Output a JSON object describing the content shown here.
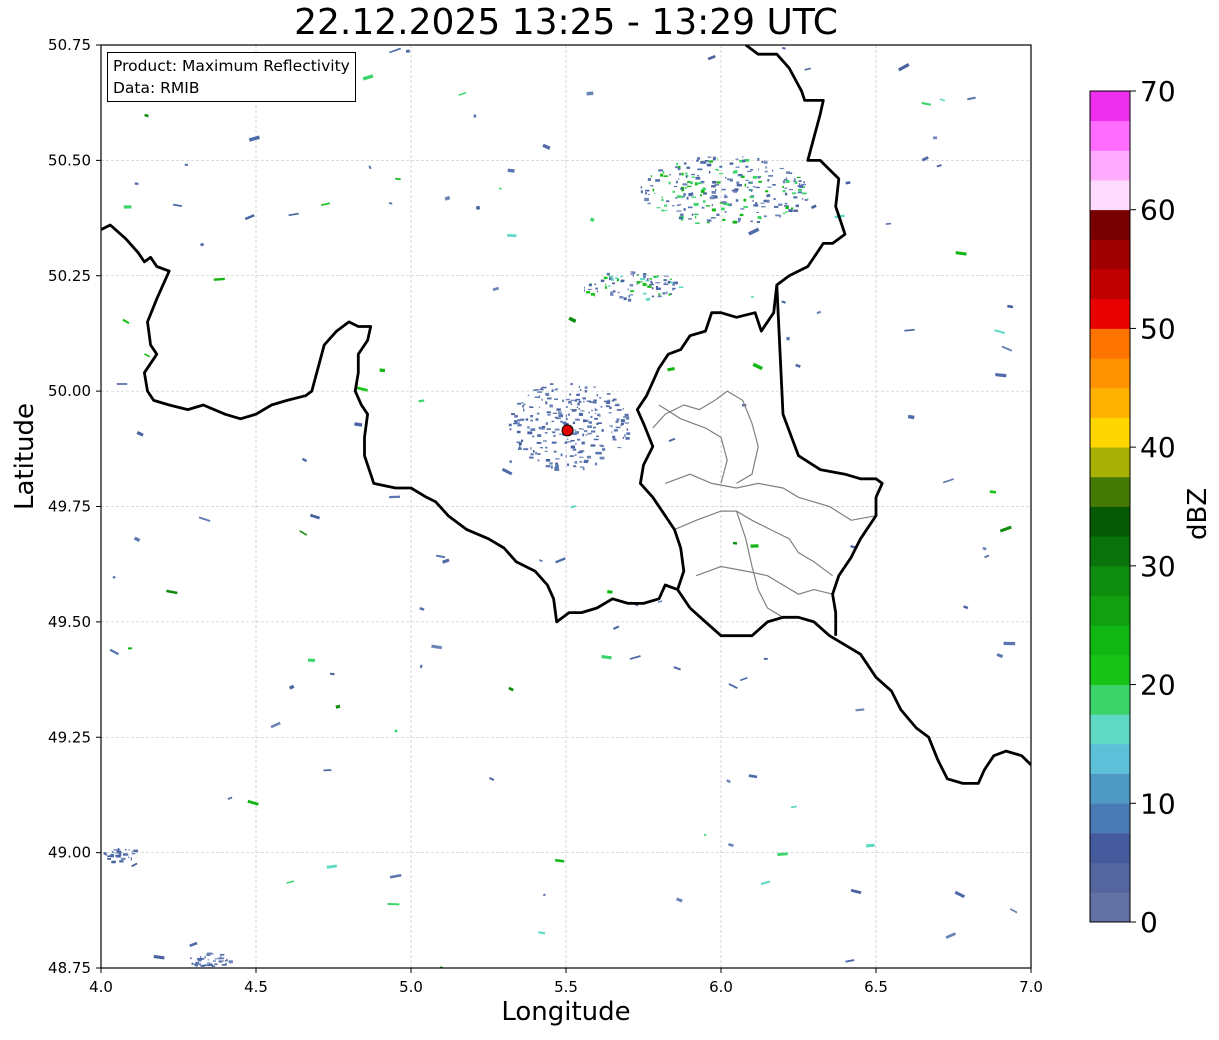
{
  "header": {
    "title": "22.12.2025 13:25 - 13:29 UTC"
  },
  "info": {
    "product": "Product: Maximum Reflectivity",
    "source": "Data: RMIB"
  },
  "axes": {
    "xlabel": "Longitude",
    "ylabel": "Latitude",
    "xlim": [
      4.0,
      7.0
    ],
    "ylim": [
      48.75,
      50.75
    ],
    "xticks": [
      "4.0",
      "4.5",
      "5.0",
      "5.5",
      "6.0",
      "6.5",
      "7.0"
    ],
    "xtick_values": [
      4.0,
      4.5,
      5.0,
      5.5,
      6.0,
      6.5,
      7.0
    ],
    "yticks": [
      "48.75",
      "49.00",
      "49.25",
      "49.50",
      "49.75",
      "50.00",
      "50.25",
      "50.50",
      "50.75"
    ],
    "ytick_values": [
      48.75,
      49.0,
      49.25,
      49.5,
      49.75,
      50.0,
      50.25,
      50.5,
      50.75
    ],
    "grid": true
  },
  "colorbar": {
    "label": "dBZ",
    "range": [
      0,
      70
    ],
    "ticks": [
      "0",
      "10",
      "20",
      "30",
      "40",
      "50",
      "60",
      "70"
    ],
    "tick_values": [
      0,
      10,
      20,
      30,
      40,
      50,
      60,
      70
    ],
    "colors": [
      "#6272a4",
      "#55669e",
      "#465b9d",
      "#4a7bb4",
      "#4f9ac4",
      "#5dbfd8",
      "#5fd8c4",
      "#3cd46a",
      "#18c418",
      "#12b612",
      "#10a010",
      "#0e8c0e",
      "#0a720a",
      "#065a06",
      "#467a06",
      "#a8b006",
      "#ffd600",
      "#ffb000",
      "#ff9200",
      "#ff7400",
      "#e80000",
      "#c00000",
      "#a00000",
      "#780000",
      "#ffdcff",
      "#ffaaff",
      "#ff6cff",
      "#ee30ee"
    ]
  },
  "radar_site": {
    "lon": 5.505,
    "lat": 49.915,
    "color": "#e00000"
  },
  "borders": {
    "country": [
      [
        [
          4.0,
          50.35
        ],
        [
          4.03,
          50.36
        ],
        [
          4.08,
          50.33
        ],
        [
          4.12,
          50.3
        ],
        [
          4.14,
          50.28
        ],
        [
          4.16,
          50.29
        ],
        [
          4.18,
          50.27
        ],
        [
          4.22,
          50.26
        ],
        [
          4.18,
          50.2
        ],
        [
          4.15,
          50.15
        ],
        [
          4.16,
          50.1
        ],
        [
          4.18,
          50.08
        ],
        [
          4.14,
          50.04
        ],
        [
          4.15,
          50.0
        ],
        [
          4.17,
          49.98
        ],
        [
          4.22,
          49.97
        ],
        [
          4.28,
          49.96
        ],
        [
          4.33,
          49.97
        ],
        [
          4.4,
          49.95
        ],
        [
          4.45,
          49.94
        ],
        [
          4.5,
          49.95
        ],
        [
          4.55,
          49.97
        ],
        [
          4.6,
          49.98
        ],
        [
          4.66,
          49.99
        ],
        [
          4.68,
          50.0
        ],
        [
          4.7,
          50.05
        ],
        [
          4.72,
          50.1
        ],
        [
          4.76,
          50.13
        ],
        [
          4.8,
          50.15
        ],
        [
          4.83,
          50.14
        ],
        [
          4.87,
          50.14
        ],
        [
          4.86,
          50.11
        ],
        [
          4.83,
          50.08
        ],
        [
          4.83,
          50.04
        ],
        [
          4.82,
          50.0
        ],
        [
          4.84,
          49.97
        ],
        [
          4.86,
          49.95
        ],
        [
          4.85,
          49.9
        ],
        [
          4.85,
          49.86
        ],
        [
          4.88,
          49.8
        ],
        [
          4.95,
          49.79
        ],
        [
          5.0,
          49.79
        ],
        [
          5.05,
          49.77
        ],
        [
          5.08,
          49.76
        ],
        [
          5.12,
          49.73
        ],
        [
          5.18,
          49.7
        ],
        [
          5.25,
          49.68
        ],
        [
          5.3,
          49.66
        ],
        [
          5.34,
          49.63
        ],
        [
          5.4,
          49.61
        ],
        [
          5.44,
          49.58
        ],
        [
          5.46,
          49.55
        ],
        [
          5.47,
          49.5
        ],
        [
          5.51,
          49.52
        ],
        [
          5.55,
          49.52
        ],
        [
          5.6,
          49.53
        ],
        [
          5.65,
          49.55
        ],
        [
          5.7,
          49.54
        ],
        [
          5.75,
          49.54
        ],
        [
          5.8,
          49.55
        ],
        [
          5.82,
          49.58
        ],
        [
          5.86,
          49.57
        ],
        [
          5.9,
          49.53
        ]
      ],
      [
        [
          5.9,
          49.53
        ],
        [
          5.95,
          49.5
        ],
        [
          6.0,
          49.47
        ],
        [
          6.05,
          49.47
        ],
        [
          6.1,
          49.47
        ],
        [
          6.15,
          49.5
        ],
        [
          6.2,
          49.51
        ],
        [
          6.25,
          49.51
        ],
        [
          6.3,
          49.5
        ],
        [
          6.35,
          49.47
        ],
        [
          6.4,
          49.45
        ],
        [
          6.45,
          49.43
        ],
        [
          6.5,
          49.38
        ],
        [
          6.55,
          49.35
        ],
        [
          6.58,
          49.31
        ],
        [
          6.63,
          49.27
        ],
        [
          6.67,
          49.25
        ],
        [
          6.7,
          49.2
        ],
        [
          6.73,
          49.16
        ],
        [
          6.78,
          49.15
        ],
        [
          6.83,
          49.15
        ],
        [
          6.85,
          49.18
        ],
        [
          6.88,
          49.21
        ],
        [
          6.92,
          49.22
        ],
        [
          6.97,
          49.21
        ],
        [
          7.0,
          49.19
        ]
      ],
      [
        [
          6.08,
          50.75
        ],
        [
          6.12,
          50.73
        ],
        [
          6.18,
          50.73
        ],
        [
          6.22,
          50.7
        ],
        [
          6.26,
          50.65
        ],
        [
          6.27,
          50.63
        ],
        [
          6.33,
          50.63
        ],
        [
          6.32,
          50.6
        ],
        [
          6.3,
          50.55
        ],
        [
          6.28,
          50.5
        ],
        [
          6.32,
          50.5
        ],
        [
          6.35,
          50.48
        ],
        [
          6.38,
          50.46
        ],
        [
          6.37,
          50.4
        ],
        [
          6.4,
          50.34
        ],
        [
          6.36,
          50.32
        ],
        [
          6.33,
          50.32
        ],
        [
          6.31,
          50.3
        ],
        [
          6.28,
          50.27
        ],
        [
          6.22,
          50.25
        ],
        [
          6.18,
          50.23
        ],
        [
          6.17,
          50.17
        ],
        [
          6.13,
          50.13
        ],
        [
          6.11,
          50.17
        ],
        [
          6.05,
          50.16
        ],
        [
          6.0,
          50.17
        ],
        [
          5.97,
          50.17
        ],
        [
          5.95,
          50.13
        ],
        [
          5.9,
          50.12
        ],
        [
          5.87,
          50.09
        ],
        [
          5.83,
          50.08
        ],
        [
          5.8,
          50.05
        ],
        [
          5.78,
          50.02
        ],
        [
          5.76,
          49.99
        ],
        [
          5.73,
          49.96
        ],
        [
          5.75,
          49.93
        ],
        [
          5.78,
          49.88
        ],
        [
          5.75,
          49.84
        ],
        [
          5.74,
          49.8
        ],
        [
          5.78,
          49.77
        ],
        [
          5.82,
          49.73
        ],
        [
          5.85,
          49.7
        ],
        [
          5.87,
          49.66
        ],
        [
          5.88,
          49.61
        ],
        [
          5.86,
          49.57
        ]
      ],
      [
        [
          6.18,
          50.23
        ],
        [
          6.2,
          49.95
        ],
        [
          6.25,
          49.86
        ],
        [
          6.32,
          49.83
        ],
        [
          6.4,
          49.82
        ],
        [
          6.45,
          49.81
        ],
        [
          6.5,
          49.81
        ],
        [
          6.52,
          49.8
        ],
        [
          6.5,
          49.77
        ],
        [
          6.5,
          49.73
        ],
        [
          6.45,
          49.68
        ],
        [
          6.42,
          49.64
        ],
        [
          6.38,
          49.6
        ],
        [
          6.36,
          49.56
        ],
        [
          6.37,
          49.52
        ],
        [
          6.37,
          49.47
        ]
      ]
    ],
    "regional": [
      [
        [
          5.78,
          49.92
        ],
        [
          5.82,
          49.95
        ],
        [
          5.88,
          49.97
        ],
        [
          5.93,
          49.96
        ],
        [
          5.98,
          49.98
        ],
        [
          6.02,
          50.0
        ],
        [
          6.07,
          49.98
        ],
        [
          6.1,
          49.93
        ],
        [
          6.12,
          49.88
        ],
        [
          6.1,
          49.82
        ],
        [
          6.05,
          49.8
        ]
      ],
      [
        [
          5.82,
          49.8
        ],
        [
          5.9,
          49.82
        ],
        [
          5.97,
          49.8
        ],
        [
          6.05,
          49.79
        ],
        [
          6.12,
          49.8
        ],
        [
          6.2,
          49.79
        ],
        [
          6.25,
          49.77
        ],
        [
          6.3,
          49.76
        ],
        [
          6.35,
          49.75
        ],
        [
          6.42,
          49.72
        ],
        [
          6.5,
          49.73
        ]
      ],
      [
        [
          5.85,
          49.7
        ],
        [
          5.92,
          49.72
        ],
        [
          6.0,
          49.74
        ],
        [
          6.05,
          49.74
        ],
        [
          6.1,
          49.72
        ],
        [
          6.16,
          49.7
        ],
        [
          6.22,
          49.68
        ],
        [
          6.25,
          49.65
        ],
        [
          6.3,
          49.63
        ],
        [
          6.36,
          49.6
        ]
      ],
      [
        [
          6.05,
          49.74
        ],
        [
          6.08,
          49.68
        ],
        [
          6.1,
          49.62
        ],
        [
          6.12,
          49.57
        ],
        [
          6.15,
          49.53
        ],
        [
          6.2,
          49.51
        ]
      ],
      [
        [
          5.92,
          49.6
        ],
        [
          6.0,
          49.62
        ],
        [
          6.08,
          49.61
        ],
        [
          6.15,
          49.6
        ],
        [
          6.2,
          49.58
        ],
        [
          6.25,
          49.56
        ],
        [
          6.3,
          49.57
        ],
        [
          6.36,
          49.56
        ]
      ],
      [
        [
          5.8,
          49.97
        ],
        [
          5.87,
          49.94
        ],
        [
          5.95,
          49.92
        ],
        [
          6.0,
          49.9
        ],
        [
          6.02,
          49.85
        ],
        [
          6.0,
          49.8
        ]
      ]
    ]
  }
}
